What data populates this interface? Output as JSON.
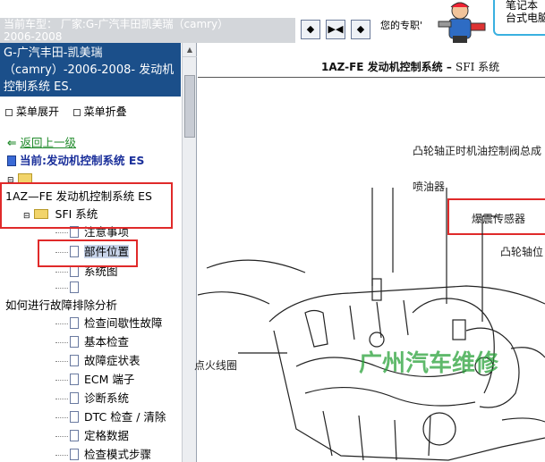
{
  "top_bar": {
    "vehicle_label": "当前车型：  厂家:G-广汽丰田凯美瑞（camry）",
    "vehicle_label_line2": "2006-2008",
    "nav_buttons": [
      "◆",
      "▶◀",
      "◆"
    ],
    "search_text": "您的专职'",
    "ad_line1": "笔记本",
    "ad_line2": "台式电脑"
  },
  "left": {
    "title": "G-广汽丰田-凯美瑞（camry）-2006-2008- 发动机控制系统 ES.",
    "menu_expand": "菜单展开",
    "menu_collapse": "菜单折叠",
    "back_link": "返回上一级",
    "current": "当前:发动机控制系统 ES",
    "tree": {
      "engine_item": "1AZ—FE 发动机控制系统 ES",
      "sfi_item": "SFI 系统",
      "children": [
        "注意事项",
        "部件位置",
        "系统图"
      ],
      "how_to": "如何进行故障排除分析",
      "subitems": [
        "检查间歇性故障",
        "基本检查",
        "故障症状表",
        "ECM 端子",
        "诊断系统",
        "DTC 检查 / 清除",
        "定格数据",
        "检查模式步骤"
      ]
    }
  },
  "doc": {
    "title_main": "1AZ-FE 发动机控制系统 –",
    "title_sub": "SFI 系统",
    "callouts": {
      "camshaft_valve": "凸轮轴正时机油控制阀总成",
      "injector": "喷油器",
      "knock_sensor": "爆震传感器",
      "camshaft_pos": "凸轮轴位",
      "ignition_coil": "点火线圈"
    },
    "watermark_text": "广州汽车维修"
  },
  "colors": {
    "title_bg": "#1b4f8a",
    "highlight_red": "#e02a2a",
    "back_link_green": "#1f8a2a",
    "current_blue": "#1a2f9a"
  }
}
